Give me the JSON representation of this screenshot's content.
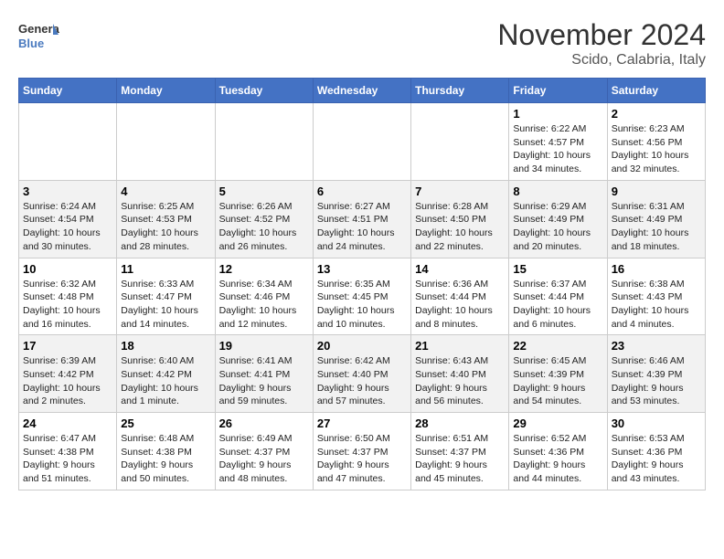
{
  "logo": {
    "line1": "General",
    "line2": "Blue"
  },
  "title": "November 2024",
  "location": "Scido, Calabria, Italy",
  "weekdays": [
    "Sunday",
    "Monday",
    "Tuesday",
    "Wednesday",
    "Thursday",
    "Friday",
    "Saturday"
  ],
  "weeks": [
    [
      {
        "day": "",
        "text": ""
      },
      {
        "day": "",
        "text": ""
      },
      {
        "day": "",
        "text": ""
      },
      {
        "day": "",
        "text": ""
      },
      {
        "day": "",
        "text": ""
      },
      {
        "day": "1",
        "text": "Sunrise: 6:22 AM\nSunset: 4:57 PM\nDaylight: 10 hours and 34 minutes."
      },
      {
        "day": "2",
        "text": "Sunrise: 6:23 AM\nSunset: 4:56 PM\nDaylight: 10 hours and 32 minutes."
      }
    ],
    [
      {
        "day": "3",
        "text": "Sunrise: 6:24 AM\nSunset: 4:54 PM\nDaylight: 10 hours and 30 minutes."
      },
      {
        "day": "4",
        "text": "Sunrise: 6:25 AM\nSunset: 4:53 PM\nDaylight: 10 hours and 28 minutes."
      },
      {
        "day": "5",
        "text": "Sunrise: 6:26 AM\nSunset: 4:52 PM\nDaylight: 10 hours and 26 minutes."
      },
      {
        "day": "6",
        "text": "Sunrise: 6:27 AM\nSunset: 4:51 PM\nDaylight: 10 hours and 24 minutes."
      },
      {
        "day": "7",
        "text": "Sunrise: 6:28 AM\nSunset: 4:50 PM\nDaylight: 10 hours and 22 minutes."
      },
      {
        "day": "8",
        "text": "Sunrise: 6:29 AM\nSunset: 4:49 PM\nDaylight: 10 hours and 20 minutes."
      },
      {
        "day": "9",
        "text": "Sunrise: 6:31 AM\nSunset: 4:49 PM\nDaylight: 10 hours and 18 minutes."
      }
    ],
    [
      {
        "day": "10",
        "text": "Sunrise: 6:32 AM\nSunset: 4:48 PM\nDaylight: 10 hours and 16 minutes."
      },
      {
        "day": "11",
        "text": "Sunrise: 6:33 AM\nSunset: 4:47 PM\nDaylight: 10 hours and 14 minutes."
      },
      {
        "day": "12",
        "text": "Sunrise: 6:34 AM\nSunset: 4:46 PM\nDaylight: 10 hours and 12 minutes."
      },
      {
        "day": "13",
        "text": "Sunrise: 6:35 AM\nSunset: 4:45 PM\nDaylight: 10 hours and 10 minutes."
      },
      {
        "day": "14",
        "text": "Sunrise: 6:36 AM\nSunset: 4:44 PM\nDaylight: 10 hours and 8 minutes."
      },
      {
        "day": "15",
        "text": "Sunrise: 6:37 AM\nSunset: 4:44 PM\nDaylight: 10 hours and 6 minutes."
      },
      {
        "day": "16",
        "text": "Sunrise: 6:38 AM\nSunset: 4:43 PM\nDaylight: 10 hours and 4 minutes."
      }
    ],
    [
      {
        "day": "17",
        "text": "Sunrise: 6:39 AM\nSunset: 4:42 PM\nDaylight: 10 hours and 2 minutes."
      },
      {
        "day": "18",
        "text": "Sunrise: 6:40 AM\nSunset: 4:42 PM\nDaylight: 10 hours and 1 minute."
      },
      {
        "day": "19",
        "text": "Sunrise: 6:41 AM\nSunset: 4:41 PM\nDaylight: 9 hours and 59 minutes."
      },
      {
        "day": "20",
        "text": "Sunrise: 6:42 AM\nSunset: 4:40 PM\nDaylight: 9 hours and 57 minutes."
      },
      {
        "day": "21",
        "text": "Sunrise: 6:43 AM\nSunset: 4:40 PM\nDaylight: 9 hours and 56 minutes."
      },
      {
        "day": "22",
        "text": "Sunrise: 6:45 AM\nSunset: 4:39 PM\nDaylight: 9 hours and 54 minutes."
      },
      {
        "day": "23",
        "text": "Sunrise: 6:46 AM\nSunset: 4:39 PM\nDaylight: 9 hours and 53 minutes."
      }
    ],
    [
      {
        "day": "24",
        "text": "Sunrise: 6:47 AM\nSunset: 4:38 PM\nDaylight: 9 hours and 51 minutes."
      },
      {
        "day": "25",
        "text": "Sunrise: 6:48 AM\nSunset: 4:38 PM\nDaylight: 9 hours and 50 minutes."
      },
      {
        "day": "26",
        "text": "Sunrise: 6:49 AM\nSunset: 4:37 PM\nDaylight: 9 hours and 48 minutes."
      },
      {
        "day": "27",
        "text": "Sunrise: 6:50 AM\nSunset: 4:37 PM\nDaylight: 9 hours and 47 minutes."
      },
      {
        "day": "28",
        "text": "Sunrise: 6:51 AM\nSunset: 4:37 PM\nDaylight: 9 hours and 45 minutes."
      },
      {
        "day": "29",
        "text": "Sunrise: 6:52 AM\nSunset: 4:36 PM\nDaylight: 9 hours and 44 minutes."
      },
      {
        "day": "30",
        "text": "Sunrise: 6:53 AM\nSunset: 4:36 PM\nDaylight: 9 hours and 43 minutes."
      }
    ]
  ]
}
